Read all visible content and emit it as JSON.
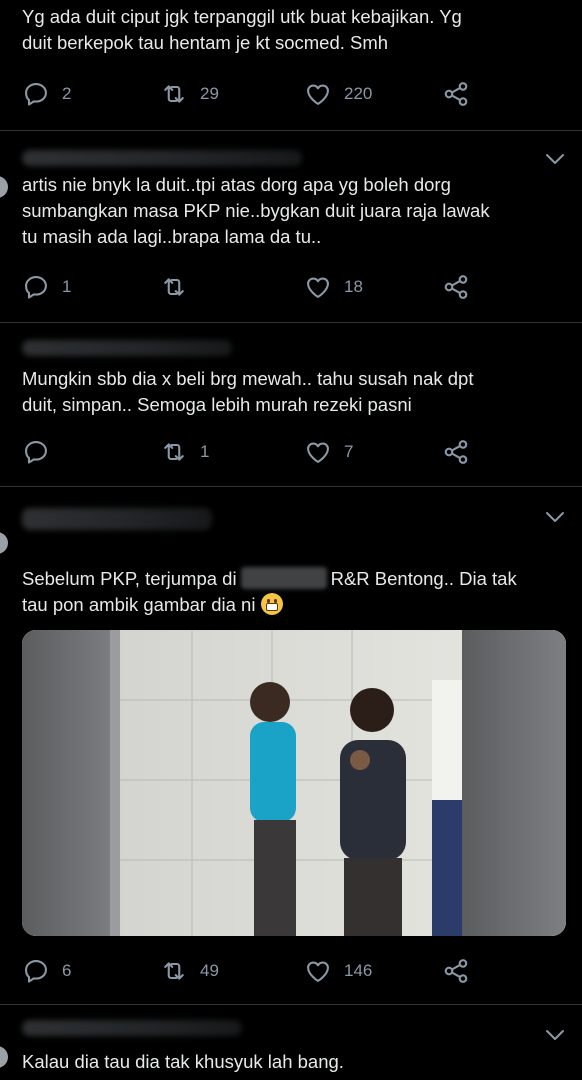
{
  "tweets": [
    {
      "text": "Yg ada duit ciput jgk terpanggil utk buat kebajikan. Yg\nduit berkepok tau hentam je kt socmed. Smh",
      "replies": "2",
      "retweets": "29",
      "likes": "220"
    },
    {
      "text": "artis nie bnyk la duit..tpi atas dorg apa yg boleh dorg\nsumbangkan masa PKP nie..bygkan duit juara raja lawak\ntu masih ada lagi..brapa lama da tu..",
      "replies": "1",
      "retweets": "",
      "likes": "18"
    },
    {
      "text": "Mungkin sbb dia x beli brg mewah.. tahu susah nak dpt\nduit, simpan.. Semoga lebih murah rezeki pasni",
      "replies": "",
      "retweets": "1",
      "likes": "7"
    },
    {
      "text_before": "Sebelum PKP, terjumpa di",
      "text_after": "R&R Bentong.. Dia tak",
      "text_line2": "tau pon ambik gambar dia ni",
      "replies": "6",
      "retweets": "49",
      "likes": "146"
    },
    {
      "text": "Kalau dia tau dia tak khusyuk lah bang."
    }
  ],
  "icons": {
    "reply": "reply-icon",
    "retweet": "retweet-icon",
    "like": "like-icon",
    "share": "share-icon",
    "more": "chevron-down-icon",
    "emoji": "grimacing-face-emoji"
  },
  "colors": {
    "background": "#000000",
    "text": "#e7e9ea",
    "muted": "#8b98a5",
    "divider": "#2f3336"
  }
}
